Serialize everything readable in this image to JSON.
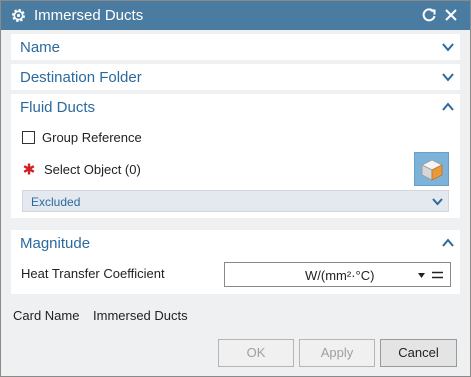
{
  "window": {
    "title": "Immersed Ducts"
  },
  "sections": {
    "name": {
      "label": "Name"
    },
    "destination": {
      "label": "Destination Folder"
    },
    "fluid_ducts": {
      "label": "Fluid Ducts",
      "group_reference": {
        "label": "Group Reference",
        "checked": false
      },
      "select_object": {
        "label": "Select Object (0)"
      },
      "excluded": {
        "label": "Excluded"
      }
    },
    "magnitude": {
      "label": "Magnitude",
      "heat_transfer": {
        "label": "Heat Transfer Coefficient",
        "unit": "W/(mm²·°C)"
      }
    }
  },
  "card": {
    "label": "Card Name",
    "value": "Immersed Ducts"
  },
  "buttons": {
    "ok": "OK",
    "apply": "Apply",
    "cancel": "Cancel"
  },
  "colors": {
    "title_bar": "#4a7ba1",
    "section_text": "#2b6a9e",
    "accent_button": "#7db3d9",
    "required": "#d02020"
  }
}
